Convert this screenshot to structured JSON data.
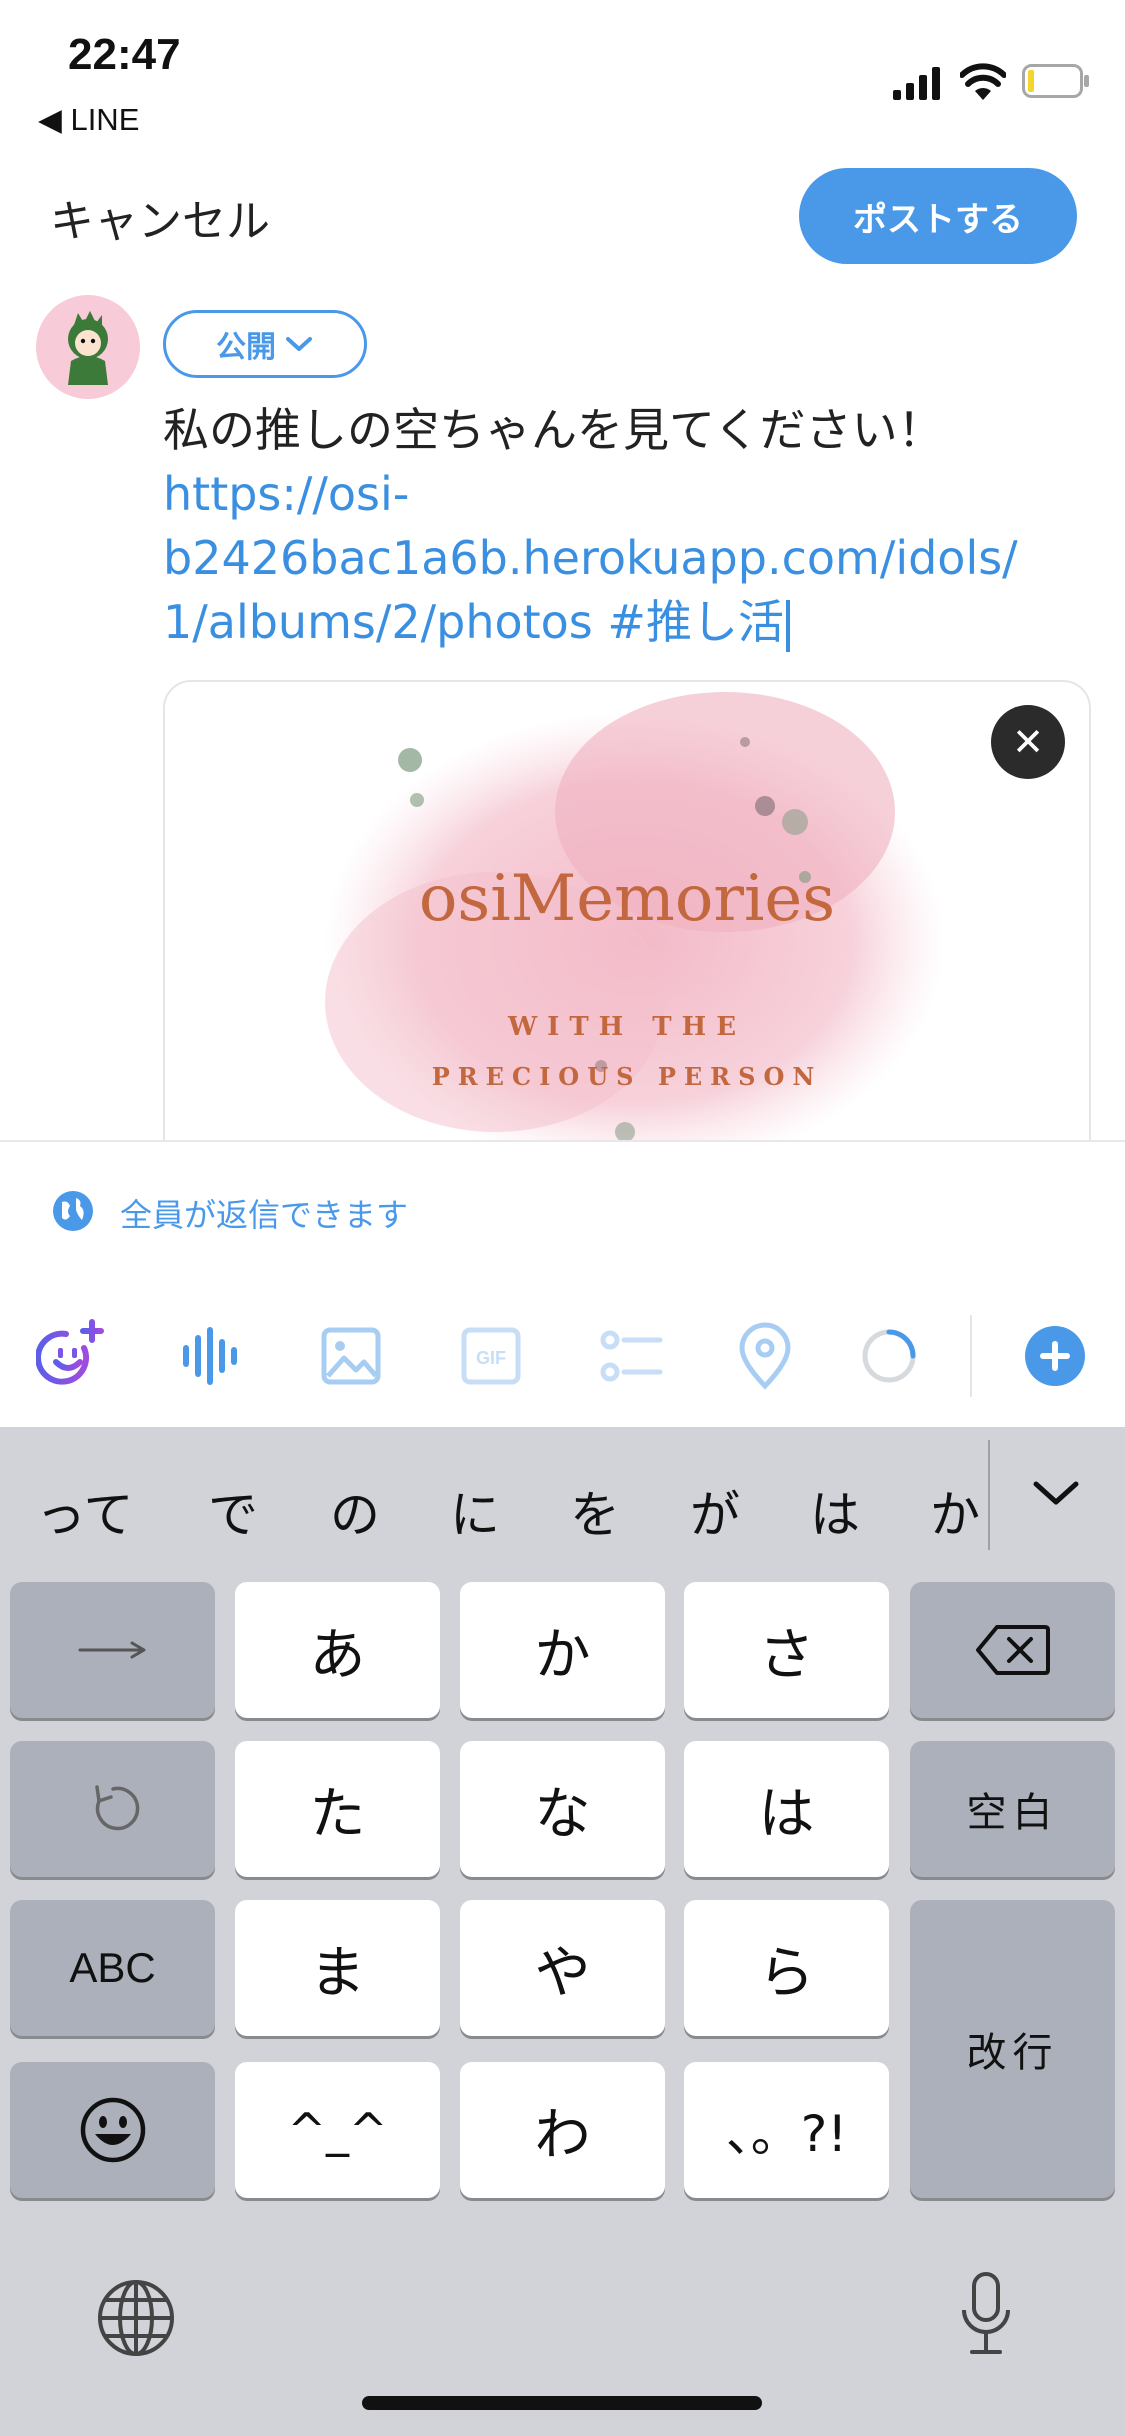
{
  "status_bar": {
    "time": "22:47",
    "back_app": "◀ LINE"
  },
  "header": {
    "cancel_label": "キャンセル",
    "post_label": "ポストする"
  },
  "composer": {
    "audience_label": "公開",
    "text_plain": "私の推しの空ちゃんを見てください！",
    "text_link_1": "https://osi-",
    "text_link_2": "b2426bac1a6b.herokuapp.com/idols/",
    "text_link_3": "1/albums/2/photos",
    "text_hashtag": " #推し活"
  },
  "card": {
    "title": "osiMemories",
    "subtitle_1": "WITH THE",
    "subtitle_2": "PRECIOUS PERSON",
    "close": "✕"
  },
  "reply_setting": {
    "label": "全員が返信できます"
  },
  "toolbar": {
    "icons": [
      "grok-icon",
      "voice-icon",
      "image-icon",
      "gif-icon",
      "poll-icon",
      "location-icon",
      "progress-icon",
      "add-icon"
    ]
  },
  "keyboard": {
    "candidates": [
      "って",
      "で",
      "の",
      "に",
      "を",
      "が",
      "は",
      "か"
    ],
    "rows": [
      [
        "→",
        "あ",
        "か",
        "さ",
        "⌫"
      ],
      [
        "↺",
        "た",
        "な",
        "は",
        "空白"
      ],
      [
        "ABC",
        "ま",
        "や",
        "ら",
        "改行"
      ],
      [
        "☺",
        "^^",
        "わ",
        "、。?!"
      ]
    ],
    "enter_label": "改行",
    "space_label": "空白",
    "abc_label": "ABC",
    "punct_label": "、。?!",
    "face_label": "^_^"
  },
  "colors": {
    "accent": "#4A99E9",
    "keyboard_bg": "#D1D3D9",
    "key_gray": "#ABB0BA"
  }
}
